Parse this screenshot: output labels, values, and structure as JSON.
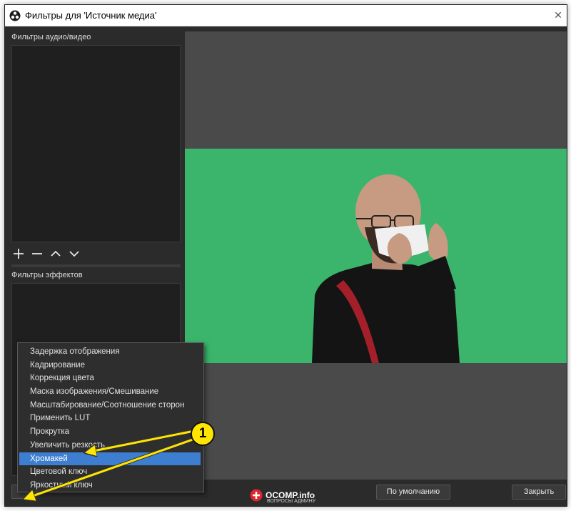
{
  "window": {
    "title": "Фильтры для 'Источник медиа'",
    "close_glyph": "✕"
  },
  "audio_video": {
    "label": "Фильтры аудио/видео"
  },
  "effects": {
    "label": "Фильтры эффектов"
  },
  "toolbar_icons": [
    "plus-icon",
    "minus-icon",
    "chevron-up-icon",
    "chevron-down-icon"
  ],
  "context_menu": {
    "items": [
      "Задержка отображения",
      "Кадрирование",
      "Коррекция цвета",
      "Маска изображения/Смешивание",
      "Масштабирование/Соотношение сторон",
      "Применить LUT",
      "Прокрутка",
      "Увеличить резкость",
      "Хромакей",
      "Цветовой ключ",
      "Яркостный ключ"
    ],
    "selected": "Хромакей"
  },
  "buttons": {
    "defaults": "По умолчанию",
    "close": "Закрыть"
  },
  "watermark": {
    "name": "OCOMP.info",
    "subtitle": "ВОПРОСЫ АДМИНУ"
  },
  "annotation": {
    "badge": "1"
  },
  "colors": {
    "green_screen": "#3bb46c",
    "selection": "#3d7ed0",
    "annotation": "#ffe600"
  }
}
